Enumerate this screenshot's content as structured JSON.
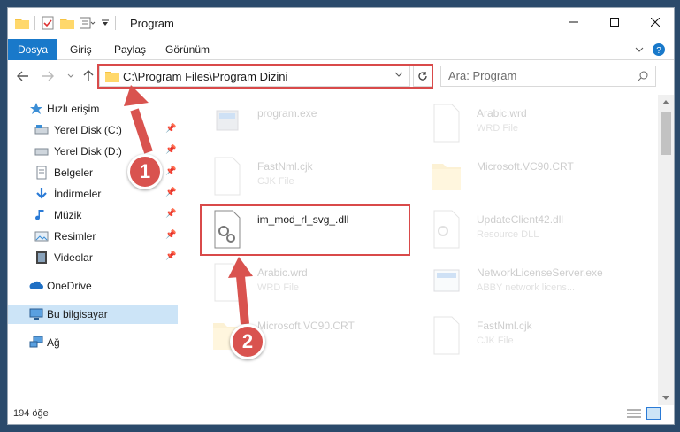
{
  "window": {
    "title": "Program"
  },
  "ribbon": {
    "tabs": [
      "Dosya",
      "Giriş",
      "Paylaş",
      "Görünüm"
    ]
  },
  "address": {
    "path": "C:\\Program Files\\Program Dizini",
    "search_placeholder": "Ara: Program"
  },
  "nav": {
    "quick_access": "Hızlı erişim",
    "items": [
      "Yerel Disk (C:)",
      "Yerel Disk (D:)",
      "Belgeler",
      "İndirmeler",
      "Müzik",
      "Resimler",
      "Videolar"
    ],
    "onedrive": "OneDrive",
    "this_pc": "Bu bilgisayar",
    "network": "Ağ"
  },
  "files": [
    {
      "name": "program.exe",
      "type": "",
      "icon": "exe-icon"
    },
    {
      "name": "Arabic.wrd",
      "type": "WRD File",
      "icon": "file-icon"
    },
    {
      "name": "FastNml.cjk",
      "type": "CJK File",
      "icon": "file-icon"
    },
    {
      "name": "Microsoft.VC90.CRT",
      "type": "",
      "icon": "folder-icon"
    },
    {
      "name": "im_mod_rl_svg_.dll",
      "type": "",
      "icon": "dll-icon"
    },
    {
      "name": "UpdateClient42.dll",
      "type": "Resource DLL",
      "icon": "dll-icon"
    },
    {
      "name": "Arabic.wrd",
      "type": "WRD File",
      "icon": "file-icon"
    },
    {
      "name": "NetworkLicenseServer.exe",
      "type": "ABBY network licens...",
      "icon": "exe-icon"
    },
    {
      "name": "Microsoft.VC90.CRT",
      "type": "",
      "icon": "folder-icon"
    },
    {
      "name": "FastNml.cjk",
      "type": "CJK File",
      "icon": "file-icon"
    }
  ],
  "status": {
    "count": "194 öğe"
  },
  "callouts": [
    "1",
    "2"
  ],
  "colors": {
    "accent": "#1979ca",
    "highlight": "#d94a4a",
    "selected": "#cce4f7"
  }
}
